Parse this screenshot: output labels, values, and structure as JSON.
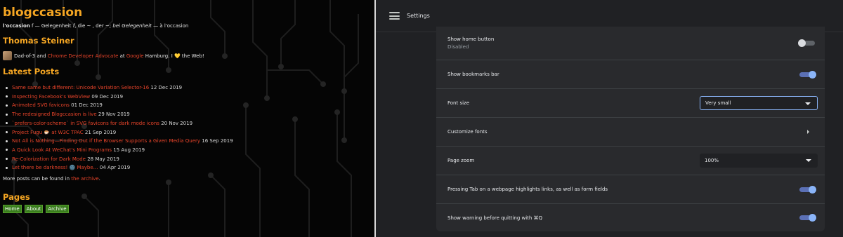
{
  "blog": {
    "site_title": "blogccasion",
    "tagline": {
      "t1": "l'occasion",
      "t2": " f — Gelegenheit ",
      "t3": "f",
      "t4": ", die ~ , der ~; ",
      "t5": "bei Gelegenheit",
      "t6": " — à l'occasion"
    },
    "author_heading": "Thomas Steiner",
    "author_bio": {
      "part1": "Dad-of-3 and ",
      "link1": "Chrome Developer Advocate",
      "part2": " at ",
      "link2": "Google",
      "part3": " Hamburg. I ",
      "heart": "💛",
      "part4": " the Web!"
    },
    "latest_heading": "Latest Posts",
    "posts": [
      {
        "title": "Same same but different: Unicode Variation Selector-16",
        "date": "12 Dec 2019"
      },
      {
        "title": "Inspecting Facebook's WebView",
        "date": "09 Dec 2019"
      },
      {
        "title": "Animated SVG favicons",
        "date": "01 Dec 2019"
      },
      {
        "title": "The redesigned Blogccasion is live",
        "date": "29 Nov 2019"
      },
      {
        "title": "`prefers-color-scheme` in SVG favicons for dark mode icons",
        "date": "20 Nov 2019"
      },
      {
        "title": "Project Fugu 🐡 at W3C TPAC",
        "date": "21 Sep 2019"
      },
      {
        "title": "Not All is Nothing—Finding Out if the Browser Supports a Given Media Query",
        "date": "16 Sep 2019"
      },
      {
        "title": "A Quick Look At WeChat's Mini Programs",
        "date": "15 Aug 2019"
      },
      {
        "title": "Re-Colorization for Dark Mode",
        "date": "28 May 2019"
      },
      {
        "title": "Let there be darkness! 🌚 Maybe…",
        "date": "04 Apr 2019"
      }
    ],
    "more_text": "More posts can be found in ",
    "more_link": "the archive",
    "more_end": ".",
    "pages_heading": "Pages",
    "pages": [
      "Home",
      "About",
      "Archive"
    ],
    "colors": {
      "accent": "#f5a623",
      "link": "#e8442a",
      "page_button": "#3a7d1e"
    }
  },
  "settings": {
    "title": "Settings",
    "menu_icon": "hamburger-menu-icon",
    "rows": {
      "home_button": {
        "label": "Show home button",
        "sub": "Disabled",
        "state": "off"
      },
      "bookmarks_bar": {
        "label": "Show bookmarks bar",
        "state": "on"
      },
      "font_size": {
        "label": "Font size",
        "value": "Very small"
      },
      "customize_fonts": {
        "label": "Customize fonts"
      },
      "page_zoom": {
        "label": "Page zoom",
        "value": "100%"
      },
      "tab_highlight": {
        "label": "Pressing Tab on a webpage highlights links, as well as form fields",
        "state": "on"
      },
      "quit_warning": {
        "label": "Show warning before quitting with ⌘Q",
        "state": "on"
      }
    },
    "colors": {
      "background": "#202124",
      "card": "#292a2d",
      "toggle_on": "#8ab4f8",
      "focus": "#8ab4f8"
    }
  }
}
